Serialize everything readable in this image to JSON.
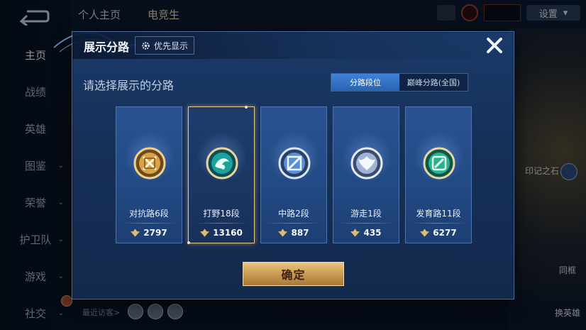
{
  "nav": {
    "items": [
      {
        "label": "主页",
        "active": true,
        "chevron": false
      },
      {
        "label": "战绩",
        "active": false,
        "chevron": false
      },
      {
        "label": "英雄",
        "active": false,
        "chevron": false
      },
      {
        "label": "图鉴",
        "active": false,
        "chevron": true
      },
      {
        "label": "荣誉",
        "active": false,
        "chevron": true
      },
      {
        "label": "护卫队",
        "active": false,
        "chevron": true
      },
      {
        "label": "游戏",
        "active": false,
        "chevron": true
      },
      {
        "label": "社交",
        "active": false,
        "chevron": true
      }
    ]
  },
  "header": {
    "tabs": [
      "个人主页",
      "电竞生"
    ],
    "settings_label": "设置"
  },
  "background": {
    "right_label_1": "印记之石",
    "right_label_2": "同框",
    "right_label_3": "换英雄",
    "recent_visitors": "最近访客>"
  },
  "dialog": {
    "title": "展示分路",
    "priority_label": "优先显示",
    "subtitle": "请选择展示的分路",
    "segment": {
      "left": "分路段位",
      "right": "巅峰分路(全国)",
      "selected": "left"
    },
    "confirm_label": "确定",
    "lanes": [
      {
        "label": "对抗路6段",
        "score": "2797",
        "icon": "clash-lane-icon",
        "color": "#d9a24a"
      },
      {
        "label": "打野18段",
        "score": "13160",
        "icon": "jungle-icon",
        "color": "#1aa39a"
      },
      {
        "label": "中路2段",
        "score": "887",
        "icon": "mid-lane-icon",
        "color": "#5a8fd8"
      },
      {
        "label": "游走1段",
        "score": "435",
        "icon": "roam-icon",
        "color": "#9fb3d6"
      },
      {
        "label": "发育路11段",
        "score": "6277",
        "icon": "farm-lane-icon",
        "color": "#26b58a"
      }
    ],
    "selected_lane": 1
  }
}
